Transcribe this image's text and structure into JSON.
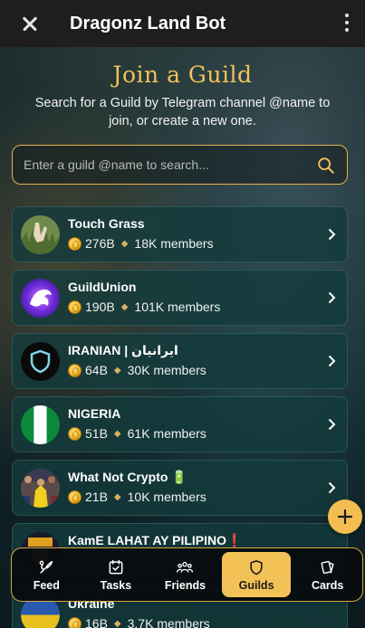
{
  "topbar": {
    "title": "Dragonz Land Bot"
  },
  "header": {
    "title": "Join a Guild",
    "subtitle": "Search for a Guild by Telegram channel @name to join, or create a new one."
  },
  "search": {
    "placeholder": "Enter a guild @name to search...",
    "value": ""
  },
  "guilds": [
    {
      "name": "Touch Grass",
      "coins": "276B",
      "members": "18K members",
      "avatar": "grass-hand-avatar"
    },
    {
      "name": "GuildUnion",
      "coins": "190B",
      "members": "101K members",
      "avatar": "dragon-avatar"
    },
    {
      "name": "IRANIAN | ایرانیان",
      "coins": "64B",
      "members": "30K members",
      "avatar": "shield-avatar"
    },
    {
      "name": "NIGERIA",
      "coins": "51B",
      "members": "61K members",
      "avatar": "nigeria-flag-avatar"
    },
    {
      "name": "What Not Crypto 🔋",
      "coins": "21B",
      "members": "10K members",
      "avatar": "crowd-avatar"
    },
    {
      "name": "KamE LAHAT AY PILIPINO❗",
      "coins": "",
      "members": "",
      "avatar": "pilipino-avatar"
    },
    {
      "name": "Ukraine",
      "coins": "16B",
      "members": "3.7K members",
      "avatar": "ukraine-avatar"
    }
  ],
  "nav": {
    "items": [
      {
        "label": "Feed",
        "icon": "feed-icon"
      },
      {
        "label": "Tasks",
        "icon": "tasks-icon"
      },
      {
        "label": "Friends",
        "icon": "friends-icon"
      },
      {
        "label": "Guilds",
        "icon": "guilds-icon",
        "active": true
      },
      {
        "label": "Cards",
        "icon": "cards-icon"
      }
    ]
  },
  "colors": {
    "accent": "#f2c257",
    "card_bg": "#143a3c",
    "title_gold": "#f1c25a"
  }
}
